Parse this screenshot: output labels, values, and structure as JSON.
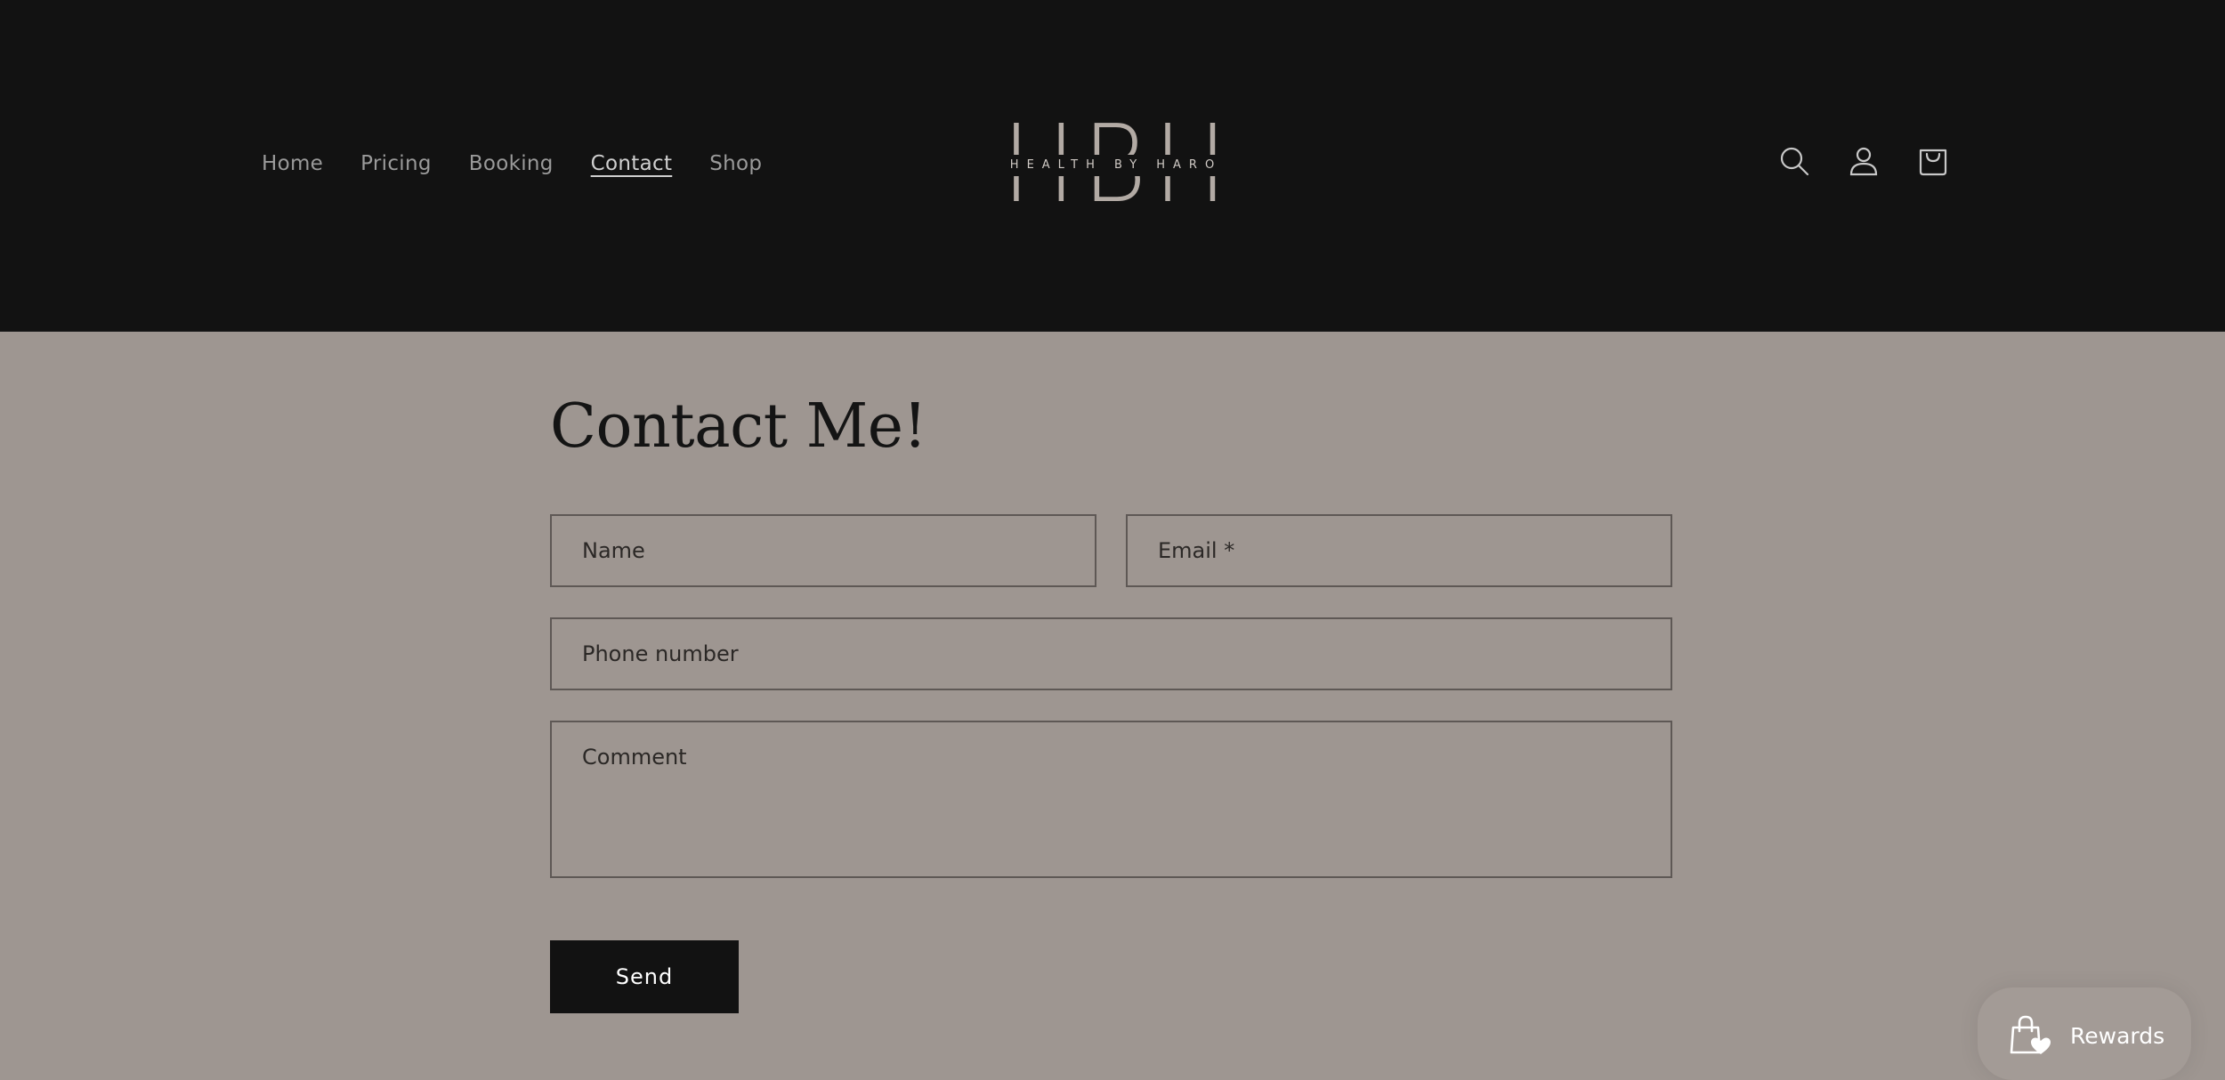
{
  "header": {
    "nav": [
      {
        "label": "Home"
      },
      {
        "label": "Pricing"
      },
      {
        "label": "Booking"
      },
      {
        "label": "Contact",
        "active": true
      },
      {
        "label": "Shop"
      }
    ],
    "logo": {
      "letters": "HBH",
      "tagline": "HEALTH BY HARO"
    },
    "icons": [
      "search-icon",
      "account-icon",
      "cart-icon"
    ]
  },
  "main": {
    "title": "Contact Me!",
    "form": {
      "name_placeholder": "Name",
      "email_placeholder": "Email *",
      "phone_placeholder": "Phone number",
      "comment_placeholder": "Comment",
      "send_label": "Send"
    }
  },
  "rewards": {
    "label": "Rewards",
    "icon": "shopping-bag-heart-icon"
  },
  "colors": {
    "header_bg": "#121212",
    "page_bg": "#9e9691",
    "logo": "#b2aaa4",
    "button_bg": "#121212"
  }
}
